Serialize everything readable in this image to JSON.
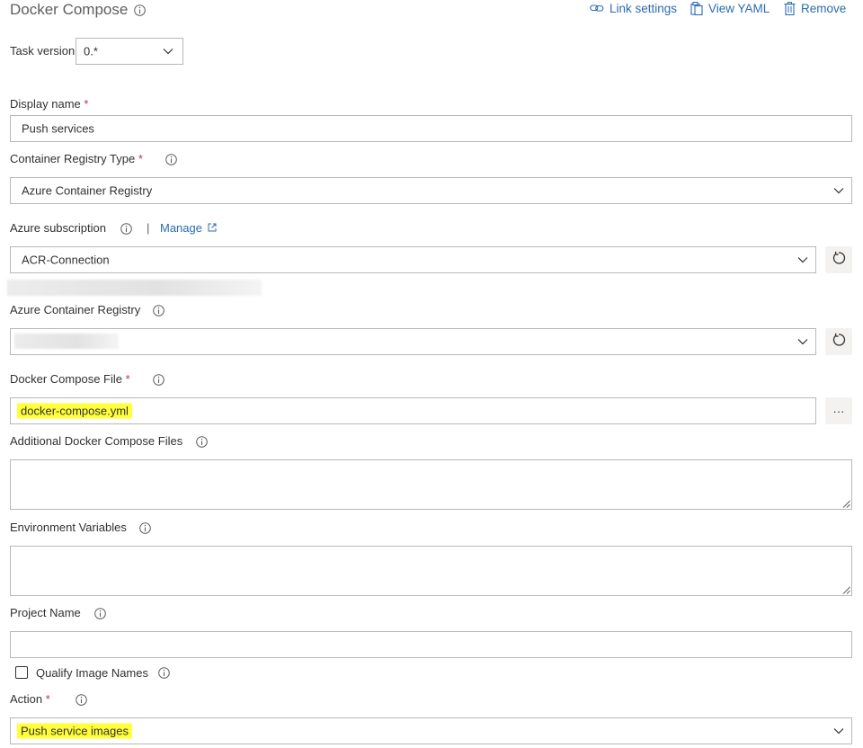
{
  "header": {
    "title": "Docker Compose",
    "link_settings": "Link settings",
    "view_yaml": "View YAML",
    "remove": "Remove"
  },
  "task_version": {
    "label": "Task version",
    "value": "0.*"
  },
  "display_name": {
    "label": "Display name",
    "required": "*",
    "value": "Push services"
  },
  "container_registry_type": {
    "label": "Container Registry Type",
    "required": "*",
    "value": "Azure Container Registry"
  },
  "azure_subscription": {
    "label": "Azure subscription",
    "separator": "|",
    "manage": "Manage",
    "value": "ACR-Connection"
  },
  "azure_container_registry": {
    "label": "Azure Container Registry",
    "value": ""
  },
  "docker_compose_file": {
    "label": "Docker Compose File",
    "required": "*",
    "value": "docker-compose.yml",
    "browse": "···"
  },
  "additional_compose_files": {
    "label": "Additional Docker Compose Files",
    "value": ""
  },
  "environment_variables": {
    "label": "Environment Variables",
    "value": ""
  },
  "project_name": {
    "label": "Project Name",
    "value": ""
  },
  "qualify_image_names": {
    "label": "Qualify Image Names",
    "checked": false
  },
  "action": {
    "label": "Action",
    "required": "*",
    "value": "Push service images"
  },
  "colors": {
    "link": "#2b6cb0",
    "required": "#c4314b",
    "highlight": "#ffff3c",
    "border": "#b8b8b8"
  }
}
